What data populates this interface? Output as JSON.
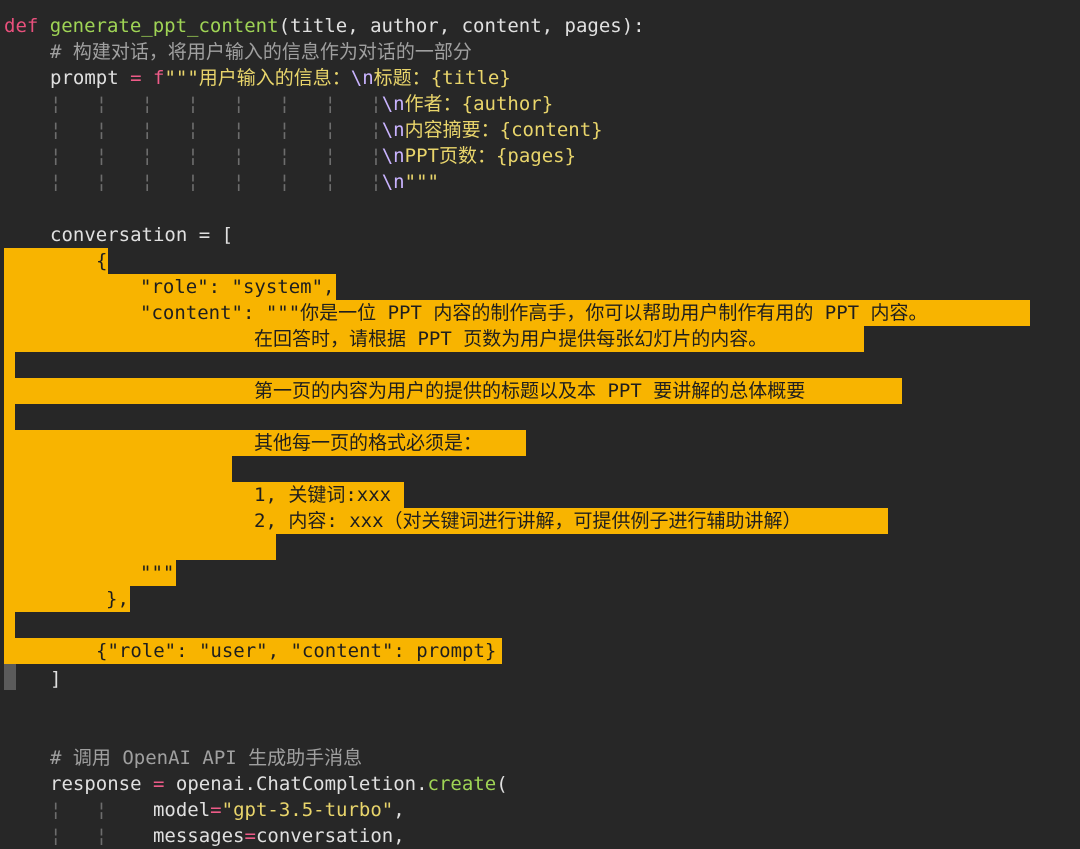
{
  "code": {
    "l1_def": "def",
    "l1_name": "generate_ppt_content",
    "l1_params": "(title, author, content, pages):",
    "l2_comment": "# 构建对话，将用户输入的信息作为对话的一部分",
    "l3_var": "prompt",
    "l3_eq": "=",
    "l3_f": "f",
    "l3_str": "\"\"\"用户输入的信息：",
    "l3_esc": "\\n",
    "l3_rest": "标题：",
    "l3_ph": "{title}",
    "l4_guides": "¦   ¦   ¦   ¦   ¦   ¦   ¦   ¦",
    "l4_esc": "\\n",
    "l4_rest": "作者：",
    "l4_ph": "{author}",
    "l5_guides": "¦   ¦   ¦   ¦   ¦   ¦   ¦   ¦",
    "l5_esc": "\\n",
    "l5_rest": "内容摘要：",
    "l5_ph": "{content}",
    "l6_guides": "¦   ¦   ¦   ¦   ¦   ¦   ¦   ¦",
    "l6_esc": "\\n",
    "l6_rest": "PPT页数：",
    "l6_ph": "{pages}",
    "l7_guides": "¦   ¦   ¦   ¦   ¦   ¦   ¦   ¦",
    "l7_esc": "\\n",
    "l7_rest": "\"\"\"",
    "l9": "conversation = [",
    "l10": "{",
    "l11": "\"role\": \"system\",",
    "l12": "\"content\": \"\"\"你是一位 PPT 内容的制作高手，你可以帮助用户制作有用的 PPT 内容。",
    "l13": "在回答时，请根据 PPT 页数为用户提供每张幻灯片的内容。",
    "l15": "第一页的内容为用户的提供的标题以及本 PPT 要讲解的总体概要",
    "l17": "其他每一页的格式必须是：",
    "l19": "1, 关键词:xxx",
    "l20": "2, 内容: xxx（对关键词进行讲解，可提供例子进行辅助讲解）",
    "l22": "\"\"\"",
    "l23": "},",
    "l25": "{\"role\": \"user\", \"content\": prompt}",
    "l26": "]",
    "l29_comment": "# 调用 OpenAI API 生成助手消息",
    "l30_var": "response",
    "l30_eq": "=",
    "l30_obj": "openai.ChatCompletion.",
    "l30_meth": "create",
    "l30_paren": "(",
    "l31_guides": "¦   ¦",
    "l31_arg": "model",
    "l31_eq": "=",
    "l31_str": "\"gpt-3.5-turbo\"",
    "l31_comma": ",",
    "l32_guides": "¦   ¦",
    "l32_arg": "messages",
    "l32_eq": "=",
    "l32_val": "conversation,"
  }
}
